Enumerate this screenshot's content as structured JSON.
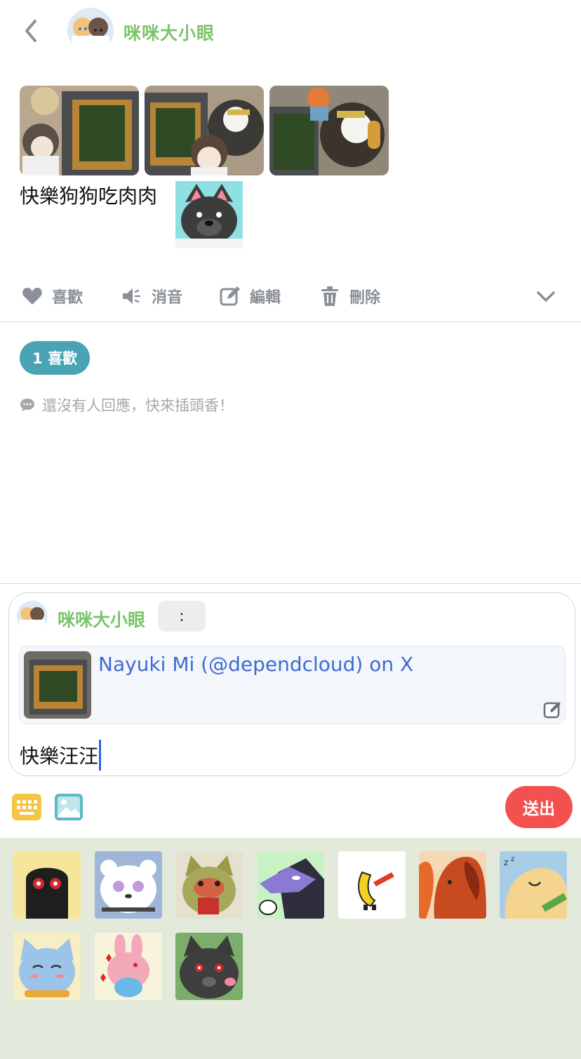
{
  "header": {
    "back_icon": "chevron-left-icon",
    "author_name": "咪咪大小眼"
  },
  "post": {
    "photos": [
      "food-photo-1",
      "food-photo-2",
      "food-photo-3"
    ],
    "text": "快樂狗狗吃肉肉",
    "sticker": "black-wolf-sticker"
  },
  "actions": {
    "like_label": "喜歡",
    "mute_label": "消音",
    "edit_label": "編輯",
    "delete_label": "刪除",
    "more_icon": "chevron-down-icon"
  },
  "likes_badge": "1 喜歡",
  "no_replies_text": "還沒有人回應，快來插頭香！",
  "composer": {
    "author_name": "咪咪大小眼",
    "colon_button": ":",
    "link_preview_title": "Nayuki Mi (@dependcloud) on X",
    "input_text": "快樂汪汪"
  },
  "toolbar": {
    "send_label": "送出",
    "keyboard_icon": "keyboard-icon",
    "image_icon": "image-icon"
  },
  "colors": {
    "name_green": "#7cc46a",
    "likes_teal": "#4aa3b5",
    "send_red": "#f2514f",
    "link_blue": "#3e6bd4",
    "tray_bg": "#e3eadb"
  },
  "sticker_tray": [
    "black-blob-sticker",
    "white-bear-sticker",
    "blushing-wolf-sticker",
    "purple-dragon-sticker",
    "banana-trumpet-sticker",
    "red-dog-sticker",
    "sleepy-dog-sticker",
    "blue-cat-sticker",
    "pink-bunny-sticker",
    "black-wolf-sticker"
  ]
}
